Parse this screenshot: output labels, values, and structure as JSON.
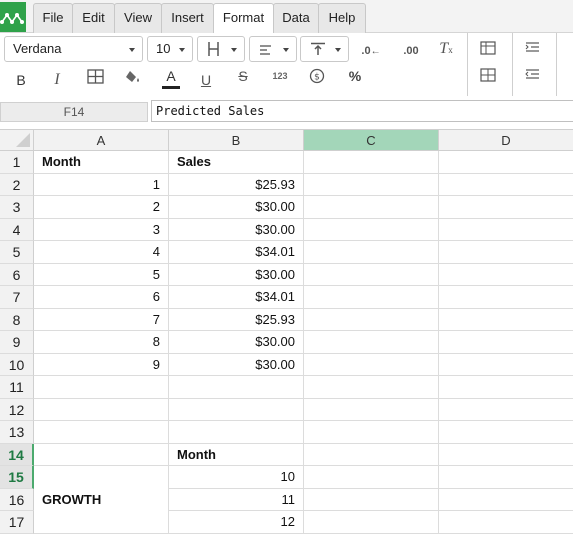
{
  "menu": {
    "items": [
      "File",
      "Edit",
      "View",
      "Insert",
      "Format",
      "Data",
      "Help"
    ],
    "active": "Format"
  },
  "toolbar": {
    "font_family": "Verdana",
    "font_size": "10",
    "bold_label": "B",
    "italic_label": "I",
    "text_color_label": "A",
    "underline_label": "U",
    "strike_label": "S",
    "number_format_label": "123",
    "percent_label": "%",
    "icons": [
      "decrease-decimals-icon",
      "increase-decimals-icon",
      "clear-format-icon",
      "insert-table-icon",
      "indent-icon",
      "borders-icon",
      "fill-color-icon",
      "currency-icon"
    ]
  },
  "formula_bar": {
    "cell_ref": "F14",
    "value": "Predicted Sales"
  },
  "columns": [
    "A",
    "B",
    "C",
    "D"
  ],
  "selected_column": "C",
  "rows": [
    "1",
    "2",
    "3",
    "4",
    "5",
    "6",
    "7",
    "8",
    "9",
    "10",
    "11",
    "12",
    "13",
    "14",
    "15",
    "16",
    "17"
  ],
  "highlighted_rows": [
    "14",
    "15"
  ],
  "cells": {
    "A1": "Month",
    "B1": "Sales",
    "A2": "1",
    "B2": "$25.93",
    "A3": "2",
    "B3": "$30.00",
    "A4": "3",
    "B4": "$30.00",
    "A5": "4",
    "B5": "$34.01",
    "A6": "5",
    "B6": "$30.00",
    "A7": "6",
    "B7": "$34.01",
    "A8": "7",
    "B8": "$25.93",
    "A9": "8",
    "B9": "$30.00",
    "A10": "9",
    "B10": "$30.00",
    "B14": "Month",
    "B15": "10",
    "B16": "11",
    "B17": "12",
    "A15_17": "GROWTH"
  }
}
